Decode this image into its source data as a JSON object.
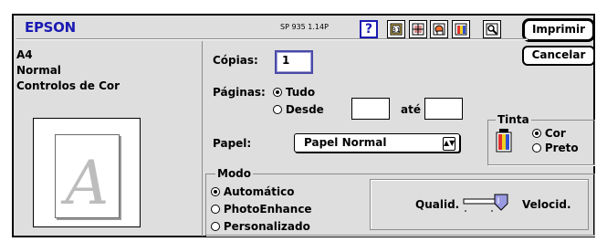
{
  "header": {
    "brand": "EPSON",
    "version": "SP 935 1.14P",
    "help_glyph": "?",
    "toolbar_icons": [
      "print-settings-icon",
      "layout-icon",
      "utilities-icon",
      "ink-icon",
      "preview-icon"
    ]
  },
  "buttons": {
    "print": "Imprimir",
    "cancel": "Cancelar"
  },
  "summary": [
    "A4",
    "Normal",
    "Controlos de Cor"
  ],
  "preview": {
    "letter": "A"
  },
  "copies": {
    "label": "Cópias:",
    "value": "1"
  },
  "pages": {
    "label": "Páginas:",
    "all": "Tudo",
    "from": "Desde",
    "to": "até",
    "from_value": "",
    "to_value": "",
    "selected": "all"
  },
  "paper": {
    "label": "Papel:",
    "value": "Papel Normal"
  },
  "ink": {
    "title": "Tinta",
    "color": "Cor",
    "black": "Preto",
    "selected": "color"
  },
  "mode": {
    "title": "Modo",
    "options": [
      "Automático",
      "PhotoEnhance",
      "Personalizado"
    ],
    "selected_index": 0
  },
  "quality": {
    "left_label": "Qualid.",
    "right_label": "Velocid."
  }
}
